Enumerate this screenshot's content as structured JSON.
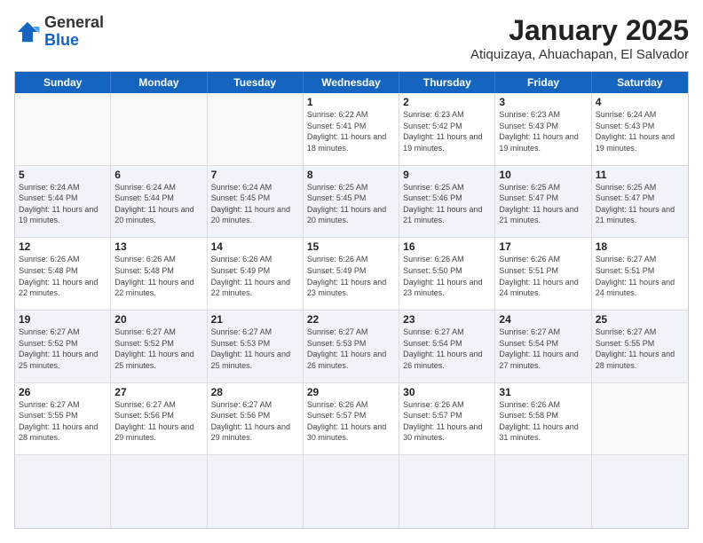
{
  "header": {
    "logo_general": "General",
    "logo_blue": "Blue",
    "month_title": "January 2025",
    "location": "Atiquizaya, Ahuachapan, El Salvador"
  },
  "weekdays": [
    "Sunday",
    "Monday",
    "Tuesday",
    "Wednesday",
    "Thursday",
    "Friday",
    "Saturday"
  ],
  "rows": [
    {
      "alt": false,
      "cells": [
        {
          "day": "",
          "info": ""
        },
        {
          "day": "",
          "info": ""
        },
        {
          "day": "",
          "info": ""
        },
        {
          "day": "1",
          "info": "Sunrise: 6:22 AM\nSunset: 5:41 PM\nDaylight: 11 hours and 18 minutes."
        },
        {
          "day": "2",
          "info": "Sunrise: 6:23 AM\nSunset: 5:42 PM\nDaylight: 11 hours and 19 minutes."
        },
        {
          "day": "3",
          "info": "Sunrise: 6:23 AM\nSunset: 5:43 PM\nDaylight: 11 hours and 19 minutes."
        },
        {
          "day": "4",
          "info": "Sunrise: 6:24 AM\nSunset: 5:43 PM\nDaylight: 11 hours and 19 minutes."
        }
      ]
    },
    {
      "alt": true,
      "cells": [
        {
          "day": "5",
          "info": "Sunrise: 6:24 AM\nSunset: 5:44 PM\nDaylight: 11 hours and 19 minutes."
        },
        {
          "day": "6",
          "info": "Sunrise: 6:24 AM\nSunset: 5:44 PM\nDaylight: 11 hours and 20 minutes."
        },
        {
          "day": "7",
          "info": "Sunrise: 6:24 AM\nSunset: 5:45 PM\nDaylight: 11 hours and 20 minutes."
        },
        {
          "day": "8",
          "info": "Sunrise: 6:25 AM\nSunset: 5:45 PM\nDaylight: 11 hours and 20 minutes."
        },
        {
          "day": "9",
          "info": "Sunrise: 6:25 AM\nSunset: 5:46 PM\nDaylight: 11 hours and 21 minutes."
        },
        {
          "day": "10",
          "info": "Sunrise: 6:25 AM\nSunset: 5:47 PM\nDaylight: 11 hours and 21 minutes."
        },
        {
          "day": "11",
          "info": "Sunrise: 6:25 AM\nSunset: 5:47 PM\nDaylight: 11 hours and 21 minutes."
        }
      ]
    },
    {
      "alt": false,
      "cells": [
        {
          "day": "12",
          "info": "Sunrise: 6:26 AM\nSunset: 5:48 PM\nDaylight: 11 hours and 22 minutes."
        },
        {
          "day": "13",
          "info": "Sunrise: 6:26 AM\nSunset: 5:48 PM\nDaylight: 11 hours and 22 minutes."
        },
        {
          "day": "14",
          "info": "Sunrise: 6:26 AM\nSunset: 5:49 PM\nDaylight: 11 hours and 22 minutes."
        },
        {
          "day": "15",
          "info": "Sunrise: 6:26 AM\nSunset: 5:49 PM\nDaylight: 11 hours and 23 minutes."
        },
        {
          "day": "16",
          "info": "Sunrise: 6:26 AM\nSunset: 5:50 PM\nDaylight: 11 hours and 23 minutes."
        },
        {
          "day": "17",
          "info": "Sunrise: 6:26 AM\nSunset: 5:51 PM\nDaylight: 11 hours and 24 minutes."
        },
        {
          "day": "18",
          "info": "Sunrise: 6:27 AM\nSunset: 5:51 PM\nDaylight: 11 hours and 24 minutes."
        }
      ]
    },
    {
      "alt": true,
      "cells": [
        {
          "day": "19",
          "info": "Sunrise: 6:27 AM\nSunset: 5:52 PM\nDaylight: 11 hours and 25 minutes."
        },
        {
          "day": "20",
          "info": "Sunrise: 6:27 AM\nSunset: 5:52 PM\nDaylight: 11 hours and 25 minutes."
        },
        {
          "day": "21",
          "info": "Sunrise: 6:27 AM\nSunset: 5:53 PM\nDaylight: 11 hours and 25 minutes."
        },
        {
          "day": "22",
          "info": "Sunrise: 6:27 AM\nSunset: 5:53 PM\nDaylight: 11 hours and 26 minutes."
        },
        {
          "day": "23",
          "info": "Sunrise: 6:27 AM\nSunset: 5:54 PM\nDaylight: 11 hours and 26 minutes."
        },
        {
          "day": "24",
          "info": "Sunrise: 6:27 AM\nSunset: 5:54 PM\nDaylight: 11 hours and 27 minutes."
        },
        {
          "day": "25",
          "info": "Sunrise: 6:27 AM\nSunset: 5:55 PM\nDaylight: 11 hours and 28 minutes."
        }
      ]
    },
    {
      "alt": false,
      "cells": [
        {
          "day": "26",
          "info": "Sunrise: 6:27 AM\nSunset: 5:55 PM\nDaylight: 11 hours and 28 minutes."
        },
        {
          "day": "27",
          "info": "Sunrise: 6:27 AM\nSunset: 5:56 PM\nDaylight: 11 hours and 29 minutes."
        },
        {
          "day": "28",
          "info": "Sunrise: 6:27 AM\nSunset: 5:56 PM\nDaylight: 11 hours and 29 minutes."
        },
        {
          "day": "29",
          "info": "Sunrise: 6:26 AM\nSunset: 5:57 PM\nDaylight: 11 hours and 30 minutes."
        },
        {
          "day": "30",
          "info": "Sunrise: 6:26 AM\nSunset: 5:57 PM\nDaylight: 11 hours and 30 minutes."
        },
        {
          "day": "31",
          "info": "Sunrise: 6:26 AM\nSunset: 5:58 PM\nDaylight: 11 hours and 31 minutes."
        },
        {
          "day": "",
          "info": ""
        }
      ]
    },
    {
      "alt": true,
      "cells": [
        {
          "day": "",
          "info": ""
        },
        {
          "day": "",
          "info": ""
        },
        {
          "day": "",
          "info": ""
        },
        {
          "day": "",
          "info": ""
        },
        {
          "day": "",
          "info": ""
        },
        {
          "day": "",
          "info": ""
        },
        {
          "day": "",
          "info": ""
        }
      ]
    }
  ]
}
